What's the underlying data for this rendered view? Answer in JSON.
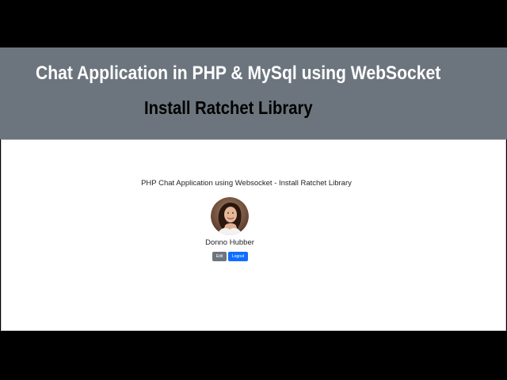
{
  "banner": {
    "title": "Chat Application in PHP & MySql using WebSocket",
    "subtitle": "Install Ratchet Library",
    "background_color": "#6c757d"
  },
  "page": {
    "heading": "PHP Chat Application using Websocket - Install Ratchet Library",
    "profile": {
      "avatar_icon": "user-photo-avatar",
      "name": "Donno Hubber"
    },
    "buttons": {
      "edit_label": "Edit",
      "logout_label": "Logout"
    },
    "colors": {
      "edit_button": "#6c757d",
      "logout_button": "#0d6efd"
    }
  }
}
